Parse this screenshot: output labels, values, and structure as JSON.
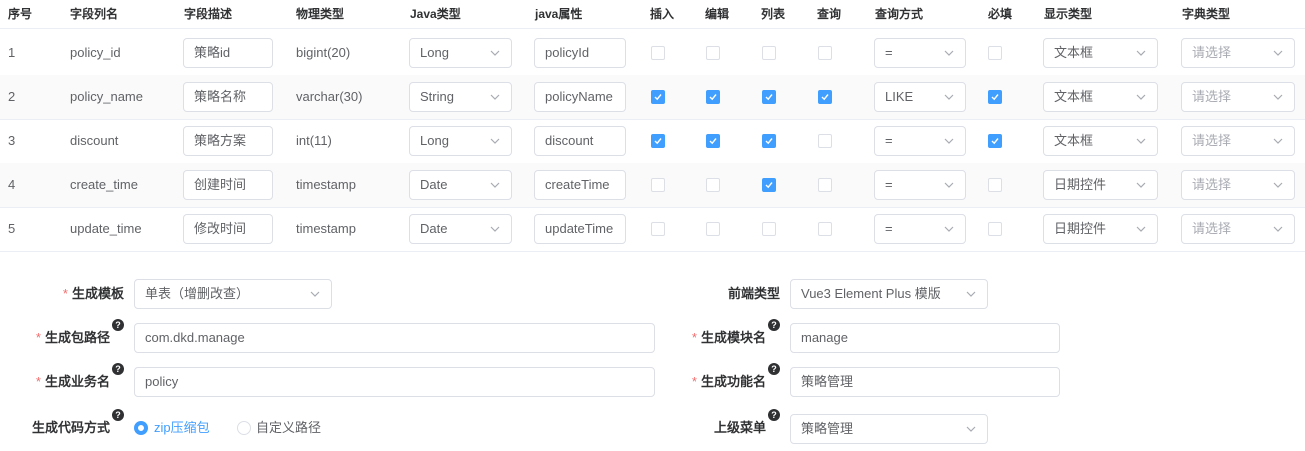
{
  "table": {
    "headers": [
      "序号",
      "字段列名",
      "字段描述",
      "物理类型",
      "Java类型",
      "java属性",
      "插入",
      "编辑",
      "列表",
      "查询",
      "查询方式",
      "必填",
      "显示类型",
      "字典类型"
    ],
    "rows": [
      {
        "idx": "1",
        "col": "policy_id",
        "desc": "策略id",
        "ptype": "bigint(20)",
        "jtype": "Long",
        "jprop": "policyId",
        "ins": false,
        "edit": false,
        "list": false,
        "query": false,
        "qtype": "=",
        "req": false,
        "show": "文本框",
        "dict": "请选择"
      },
      {
        "idx": "2",
        "col": "policy_name",
        "desc": "策略名称",
        "ptype": "varchar(30)",
        "jtype": "String",
        "jprop": "policyName",
        "ins": true,
        "edit": true,
        "list": true,
        "query": true,
        "qtype": "LIKE",
        "req": true,
        "show": "文本框",
        "dict": "请选择"
      },
      {
        "idx": "3",
        "col": "discount",
        "desc": "策略方案",
        "ptype": "int(11)",
        "jtype": "Long",
        "jprop": "discount",
        "ins": true,
        "edit": true,
        "list": true,
        "query": false,
        "qtype": "=",
        "req": true,
        "show": "文本框",
        "dict": "请选择"
      },
      {
        "idx": "4",
        "col": "create_time",
        "desc": "创建时间",
        "ptype": "timestamp",
        "jtype": "Date",
        "jprop": "createTime",
        "ins": false,
        "edit": false,
        "list": true,
        "query": false,
        "qtype": "=",
        "req": false,
        "show": "日期控件",
        "dict": "请选择"
      },
      {
        "idx": "5",
        "col": "update_time",
        "desc": "修改时间",
        "ptype": "timestamp",
        "jtype": "Date",
        "jprop": "updateTime",
        "ins": false,
        "edit": false,
        "list": false,
        "query": false,
        "qtype": "=",
        "req": false,
        "show": "日期控件",
        "dict": "请选择"
      }
    ]
  },
  "form": {
    "tpl_label": "生成模板",
    "tpl_value": "单表（增删改查）",
    "front_label": "前端类型",
    "front_value": "Vue3 Element Plus 模版",
    "pkg_label": "生成包路径",
    "pkg_value": "com.dkd.manage",
    "module_label": "生成模块名",
    "module_value": "manage",
    "biz_label": "生成业务名",
    "biz_value": "policy",
    "func_label": "生成功能名",
    "func_value": "策略管理",
    "mode_label": "生成代码方式",
    "mode_opt1": "zip压缩包",
    "mode_opt2": "自定义路径",
    "parent_label": "上级菜单",
    "parent_value": "策略管理",
    "required_mark": "*",
    "help_mark": "?"
  },
  "colors": {
    "accent": "#409eff",
    "required": "#f56c6c",
    "border": "#dcdfe6",
    "placeholder": "#a8abb2"
  }
}
